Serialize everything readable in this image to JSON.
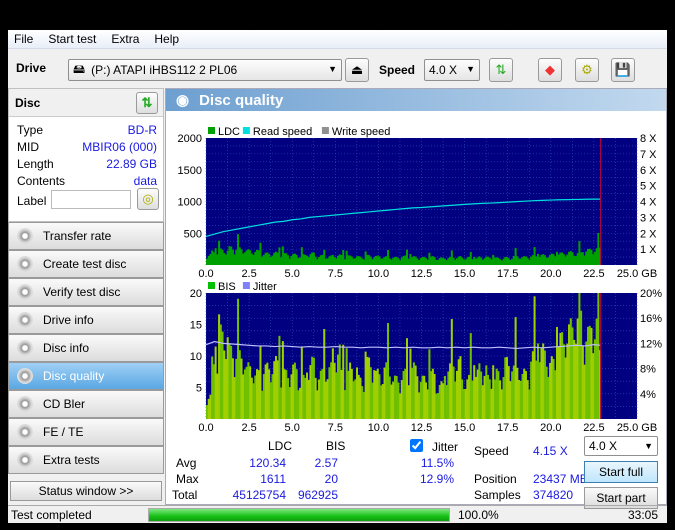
{
  "menu": [
    "File",
    "Start test",
    "Extra",
    "Help"
  ],
  "toolbar": {
    "drive_label": "Drive",
    "drive_value": "(P:)  ATAPI iHBS112  2 PL06",
    "speed_label": "Speed",
    "speed_value": "4.0 X"
  },
  "disc": {
    "title": "Disc",
    "fields": [
      {
        "k": "Type",
        "v": "BD-R"
      },
      {
        "k": "MID",
        "v": "MBIR06 (000)"
      },
      {
        "k": "Length",
        "v": "22.89 GB"
      },
      {
        "k": "Contents",
        "v": "data"
      }
    ],
    "label_label": "Label",
    "label_value": ""
  },
  "nav": [
    {
      "label": "Transfer rate"
    },
    {
      "label": "Create test disc"
    },
    {
      "label": "Verify test disc"
    },
    {
      "label": "Drive info"
    },
    {
      "label": "Disc info"
    },
    {
      "label": "Disc quality",
      "active": true
    },
    {
      "label": "CD Bler"
    },
    {
      "label": "FE / TE"
    },
    {
      "label": "Extra tests"
    }
  ],
  "status_window": "Status window >>",
  "panel_title": "Disc quality",
  "colors": {
    "ldc": "#00a000",
    "read": "#00e0e0",
    "write": "#909090",
    "bis": "#00c000",
    "jitter": "#8080ff",
    "plot_bg": "#000080",
    "end_marker": "#c00040"
  },
  "chart_data": [
    {
      "type": "bar",
      "legend": [
        "LDC",
        "Read speed",
        "Write speed"
      ],
      "xlim": [
        0,
        25
      ],
      "ylim": [
        0,
        2000
      ],
      "y2lim": [
        0,
        8
      ],
      "xticks": [
        "0.0",
        "2.5",
        "5.0",
        "7.5",
        "10.0",
        "12.5",
        "15.0",
        "17.5",
        "20.0",
        "22.5",
        "25.0 GB"
      ],
      "yticks": [
        "500",
        "1000",
        "1500",
        "2000"
      ],
      "y2ticks": [
        "1 X",
        "2 X",
        "3 X",
        "4 X",
        "5 X",
        "6 X",
        "7 X",
        "8 X"
      ],
      "x": [
        0,
        0.5,
        1,
        1.5,
        2,
        2.5,
        3,
        3.5,
        4,
        4.5,
        5,
        5.5,
        6,
        6.5,
        7,
        7.5,
        8,
        8.5,
        9,
        9.5,
        10,
        10.5,
        11,
        11.5,
        12,
        12.5,
        13,
        13.5,
        14,
        14.5,
        15,
        15.5,
        16,
        16.5,
        17,
        17.5,
        18,
        18.5,
        19,
        19.5,
        20,
        20.5,
        21,
        21.5,
        22,
        22.5,
        22.89
      ],
      "ldc": [
        180,
        230,
        260,
        300,
        280,
        250,
        240,
        200,
        210,
        190,
        180,
        170,
        200,
        160,
        150,
        170,
        160,
        150,
        140,
        160,
        150,
        140,
        130,
        150,
        140,
        130,
        140,
        120,
        130,
        140,
        130,
        120,
        140,
        130,
        120,
        130,
        150,
        140,
        160,
        170,
        180,
        200,
        220,
        210,
        260,
        280,
        300
      ],
      "read_speed": [
        1.8,
        1.95,
        2.1,
        2.2,
        2.3,
        2.4,
        2.5,
        2.6,
        2.7,
        2.75,
        2.85,
        2.9,
        3.0,
        3.05,
        3.1,
        3.15,
        3.2,
        3.25,
        3.3,
        3.35,
        3.4,
        3.45,
        3.5,
        3.55,
        3.6,
        3.62,
        3.66,
        3.7,
        3.74,
        3.78,
        3.82,
        3.85,
        3.88,
        3.9,
        3.93,
        3.96,
        3.99,
        4.02,
        4.05,
        4.07,
        4.09,
        4.11,
        4.12,
        4.13,
        4.14,
        4.15,
        4.15
      ]
    },
    {
      "type": "bar",
      "legend": [
        "BIS",
        "Jitter"
      ],
      "xlim": [
        0,
        25
      ],
      "ylim": [
        0,
        20
      ],
      "y2lim": [
        0,
        20
      ],
      "xticks": [
        "0.0",
        "2.5",
        "5.0",
        "7.5",
        "10.0",
        "12.5",
        "15.0",
        "17.5",
        "20.0",
        "22.5",
        "25.0 GB"
      ],
      "yticks": [
        "5",
        "10",
        "15",
        "20"
      ],
      "y2ticks": [
        "4%",
        "8%",
        "12%",
        "16%",
        "20%"
      ],
      "x": [
        0,
        0.5,
        1,
        1.5,
        2,
        2.5,
        3,
        3.5,
        4,
        4.5,
        5,
        5.5,
        6,
        6.5,
        7,
        7.5,
        8,
        8.5,
        9,
        9.5,
        10,
        10.5,
        11,
        11.5,
        12,
        12.5,
        13,
        13.5,
        14,
        14.5,
        15,
        15.5,
        16,
        16.5,
        17,
        17.5,
        18,
        18.5,
        19,
        19.5,
        20,
        20.5,
        21,
        21.5,
        22,
        22.5,
        22.89
      ],
      "bis": [
        4,
        10,
        15,
        12,
        11,
        9,
        8,
        9,
        10,
        8,
        9,
        7,
        10,
        8,
        9,
        12,
        8,
        9,
        7,
        10,
        8,
        9,
        7,
        8,
        9,
        7,
        8,
        6,
        9,
        10,
        7,
        8,
        9,
        7,
        8,
        10,
        9,
        8,
        11,
        12,
        10,
        14,
        16,
        18,
        15,
        17,
        12
      ],
      "jitter": [
        11.8,
        12.3,
        12.0,
        11.9,
        11.8,
        11.7,
        11.6,
        11.6,
        11.5,
        11.6,
        11.5,
        11.4,
        11.5,
        11.4,
        11.4,
        11.5,
        11.4,
        11.4,
        11.3,
        11.4,
        11.4,
        11.3,
        11.4,
        11.3,
        11.4,
        11.3,
        11.3,
        11.4,
        11.3,
        11.4,
        11.3,
        11.4,
        11.3,
        11.3,
        11.4,
        11.3,
        11.2,
        11.3,
        11.4,
        11.3,
        11.4,
        11.5,
        11.6,
        11.7,
        11.6,
        11.8,
        11.7
      ]
    }
  ],
  "stats": {
    "col_ldc": "LDC",
    "col_bis": "BIS",
    "col_jitter": "Jitter",
    "jitter_checked": true,
    "avg_label": "Avg",
    "max_label": "Max",
    "total_label": "Total",
    "avg_ldc": "120.34",
    "avg_bis": "2.57",
    "avg_jitter": "11.5%",
    "max_ldc": "1611",
    "max_bis": "20",
    "max_jitter": "12.9%",
    "total_ldc": "45125754",
    "total_bis": "962925",
    "speed_label": "Speed",
    "speed_value": "4.15 X",
    "position_label": "Position",
    "position_value": "23437 MB",
    "samples_label": "Samples",
    "samples_value": "374820",
    "speed_select": "4.0 X",
    "start_full": "Start full",
    "start_part": "Start part"
  },
  "statusbar": {
    "text": "Test completed",
    "progress": 100,
    "progress_text": "100.0%",
    "time": "33:05"
  }
}
